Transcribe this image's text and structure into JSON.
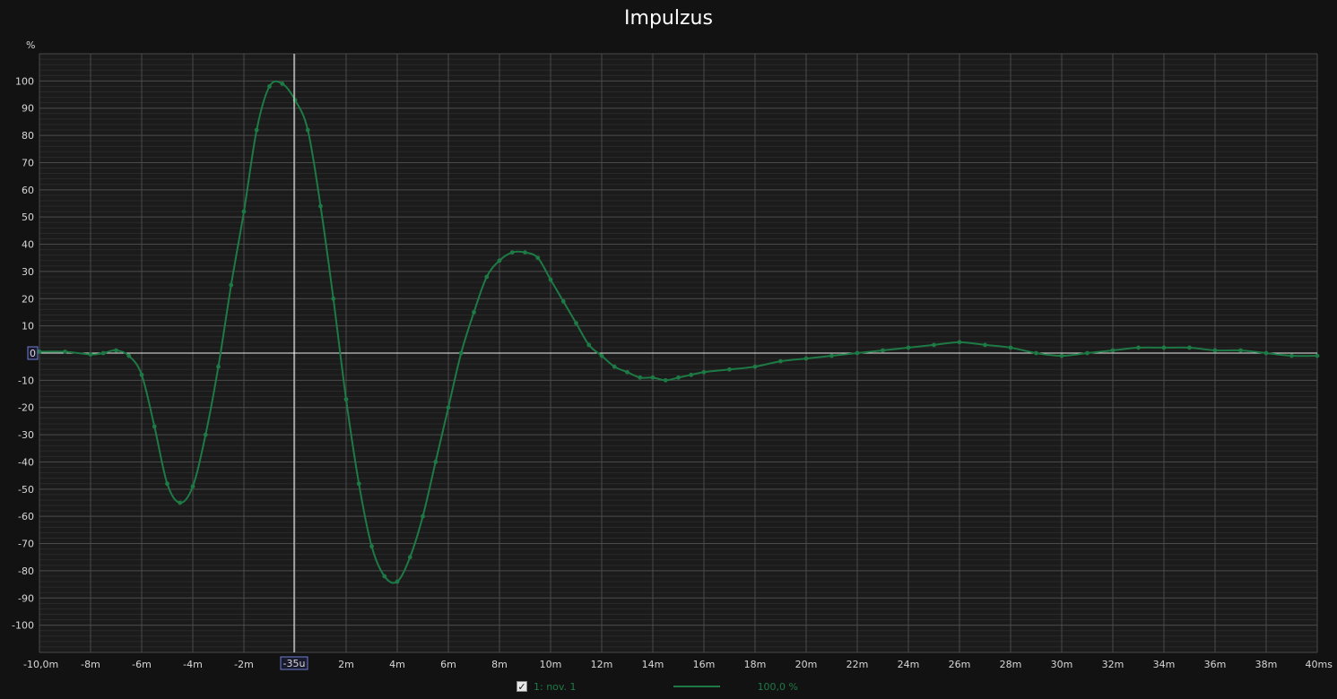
{
  "colors": {
    "background": "#121212",
    "plot_background": "#1b1b1b",
    "grid_major": "#4a4a4a",
    "grid_minor": "#2a2a2a",
    "series": "#1d7a45",
    "cursor": "#ffffff",
    "cursor_label_border": "#6f7fd0"
  },
  "legend": {
    "checkbox_checked": true,
    "series_name": "1: nov. 1",
    "series_value": "100,0 %"
  },
  "chart_data": {
    "type": "line",
    "title": "Impulzus",
    "ylabel": "%",
    "xlabel": "",
    "xlim": [
      -10,
      40
    ],
    "ylim": [
      -110,
      110
    ],
    "grid": true,
    "legend_position": "bottom",
    "x_tick_labels": [
      "-10,0m",
      "-8m",
      "-6m",
      "-4m",
      "-2m",
      "-35u",
      "2m",
      "4m",
      "6m",
      "8m",
      "10m",
      "12m",
      "14m",
      "16m",
      "18m",
      "20m",
      "22m",
      "24m",
      "26m",
      "28m",
      "30m",
      "32m",
      "34m",
      "36m",
      "38m",
      "40ms"
    ],
    "y_ticks": [
      100,
      90,
      80,
      70,
      60,
      50,
      40,
      30,
      20,
      10,
      0,
      -10,
      -20,
      -30,
      -40,
      -50,
      -60,
      -70,
      -80,
      -90,
      -100
    ],
    "cursor": {
      "x": -0.035,
      "x_label": "-35u",
      "y_label": "0"
    },
    "series": [
      {
        "name": "1: nov. 1",
        "x": [
          -10,
          -9,
          -8,
          -7.5,
          -7,
          -6.5,
          -6,
          -5.5,
          -5,
          -4.5,
          -4,
          -3.5,
          -3,
          -2.5,
          -2,
          -1.5,
          -1,
          -0.5,
          0,
          0.5,
          1,
          1.5,
          2,
          2.5,
          3,
          3.5,
          4,
          4.5,
          5,
          5.5,
          6,
          6.5,
          7,
          7.5,
          8,
          8.5,
          9,
          9.5,
          10,
          10.5,
          11,
          11.5,
          12,
          12.5,
          13,
          13.5,
          14,
          14.5,
          15,
          15.5,
          16,
          17,
          18,
          19,
          20,
          21,
          22,
          23,
          24,
          25,
          26,
          27,
          28,
          29,
          30,
          31,
          32,
          33,
          34,
          35,
          36,
          37,
          38,
          39,
          40
        ],
        "y": [
          0.5,
          0.5,
          -0.5,
          0,
          1,
          -1,
          -8,
          -27,
          -48,
          -55,
          -49,
          -30,
          -5,
          25,
          52,
          82,
          98,
          99,
          93,
          82,
          54,
          20,
          -17,
          -48,
          -71,
          -82,
          -84,
          -75,
          -60,
          -40,
          -20,
          0,
          15,
          28,
          34,
          37,
          37,
          35,
          27,
          19,
          11,
          3,
          -1,
          -5,
          -7,
          -9,
          -9,
          -10,
          -9,
          -8,
          -7,
          -6,
          -5,
          -3,
          -2,
          -1,
          0,
          1,
          2,
          3,
          4,
          3,
          2,
          0,
          -1,
          0,
          1,
          2,
          2,
          2,
          1,
          1,
          0,
          -1,
          -1
        ]
      }
    ]
  }
}
